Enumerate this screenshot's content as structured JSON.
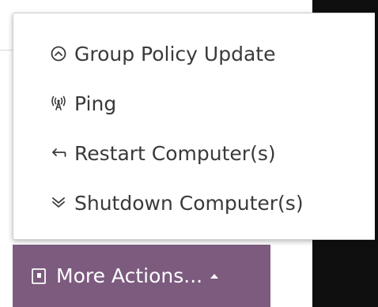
{
  "menu": {
    "items": [
      {
        "icon": "circle-chevron-up-icon",
        "label": "Group Policy Update"
      },
      {
        "icon": "broadcast-tower-icon",
        "label": "Ping"
      },
      {
        "icon": "restart-arrow-icon",
        "label": "Restart Computer(s)"
      },
      {
        "icon": "double-chevron-down-icon",
        "label": "Shutdown Computer(s)"
      }
    ]
  },
  "button": {
    "icon": "document-icon",
    "label": "More Actions...",
    "caret_icon": "caret-up-icon",
    "color": "#7c5b7f"
  },
  "colors": {
    "menu_text": "#3a3a3a",
    "background_right": "#0f0f0f"
  }
}
